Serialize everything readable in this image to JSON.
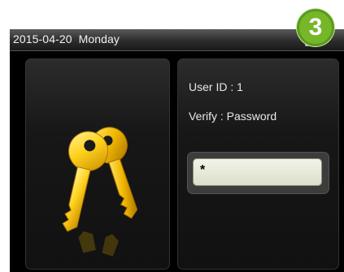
{
  "status_bar": {
    "datetime": "2015-04-20  Monday"
  },
  "verify_info": {
    "user_id_text": "User ID : 1",
    "verify_text": "Verify : Password",
    "password_value": "*"
  },
  "step_badge": {
    "number": "3",
    "color": "#76b72a"
  },
  "icons": {
    "key": "keys-icon",
    "status": "device-status-icon"
  },
  "colors": {
    "background": "#000000",
    "text": "#e8e8e8",
    "key_gold": "#f5c000",
    "field": "#e6e8d6"
  }
}
